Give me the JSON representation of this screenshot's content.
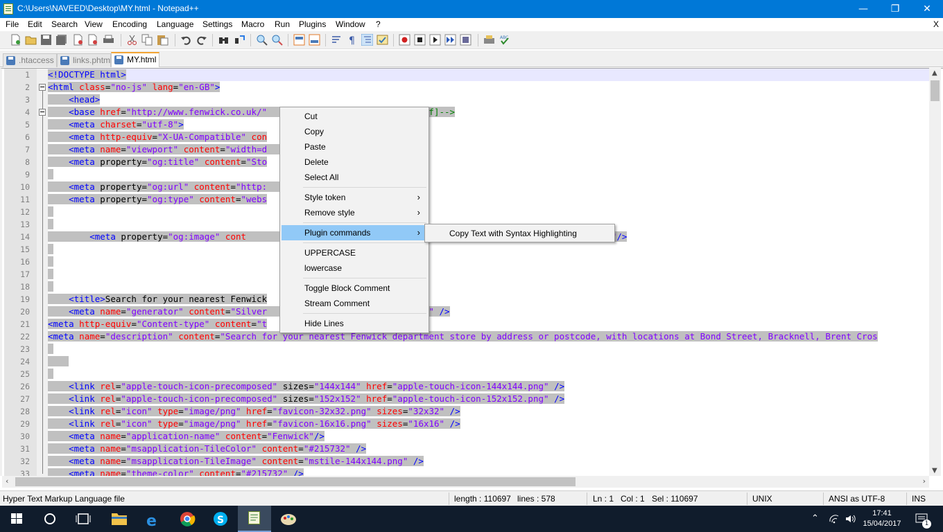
{
  "window": {
    "title": "C:\\Users\\NAVEED\\Desktop\\MY.html - Notepad++",
    "minimize": "—",
    "maximize": "❐",
    "close": "✕"
  },
  "menubar": {
    "items": [
      "File",
      "Edit",
      "Search",
      "View",
      "Encoding",
      "Language",
      "Settings",
      "Macro",
      "Run",
      "Plugins",
      "Window",
      "?"
    ],
    "doc_close": "X"
  },
  "tabs": [
    {
      "label": ".htaccess",
      "active": false
    },
    {
      "label": "links.phtml",
      "active": false
    },
    {
      "label": "MY.html",
      "active": true
    }
  ],
  "editor": {
    "lines": [
      {
        "n": "1",
        "indent": "",
        "html": "<span class=\"tg\">&lt;!DOCTYPE html&gt;</span>"
      },
      {
        "n": "2",
        "indent": "",
        "html": "<span class=\"tg\">&lt;html</span> <span class=\"at\">class</span>=<span class=\"vl\">\"no-js\"</span> <span class=\"at\">lang</span>=<span class=\"vl\">\"en-GB\"</span><span class=\"tg\">&gt;</span>"
      },
      {
        "n": "3",
        "indent": "    ",
        "html": "<span class=\"tg\">&lt;head&gt;</span>"
      },
      {
        "n": "4",
        "indent": "    ",
        "html": "<span class=\"tg\">&lt;base</span> <span class=\"at\">href</span>=<span class=\"vl\">\"http://www.fenwick.co.uk/\"</span>                         <span class=\"cm\">![endif]--&gt;</span>"
      },
      {
        "n": "5",
        "indent": "    ",
        "html": "<span class=\"tg\">&lt;meta</span> <span class=\"at\">charset</span>=<span class=\"vl\">\"utf-8\"</span><span class=\"tg\">&gt;</span>"
      },
      {
        "n": "6",
        "indent": "    ",
        "html": "<span class=\"tg\">&lt;meta</span> <span class=\"at\">http-equiv</span>=<span class=\"vl\">\"X-UA-Compatible\"</span> <span class=\"at\">con</span>"
      },
      {
        "n": "7",
        "indent": "    ",
        "html": "<span class=\"tg\">&lt;meta</span> <span class=\"at\">name</span>=<span class=\"vl\">\"viewport\"</span> <span class=\"at\">content</span>=<span class=\"vl\">\"width=d</span>                          <span class=\"vl\">1\"</span><span class=\"tg\">&gt;</span>"
      },
      {
        "n": "8",
        "indent": "    ",
        "html": "<span class=\"tg\">&lt;meta</span> property=<span class=\"vl\">\"og:title\"</span> <span class=\"at\">content</span>=<span class=\"vl\">\"Sto</span>"
      },
      {
        "n": "9",
        "indent": "",
        "html": " "
      },
      {
        "n": "10",
        "indent": "    ",
        "html": "<span class=\"tg\">&lt;meta</span> property=<span class=\"vl\">\"og:url\"</span> <span class=\"at\">content</span>=<span class=\"vl\">\"http:</span>                            <span class=\"vl\">\"</span><span class=\"tg\">/&gt;</span>"
      },
      {
        "n": "11",
        "indent": "    ",
        "html": "<span class=\"tg\">&lt;meta</span> property=<span class=\"vl\">\"og:type\"</span> <span class=\"at\">content</span>=<span class=\"vl\">\"webs</span>"
      },
      {
        "n": "12",
        "indent": "",
        "html": " "
      },
      {
        "n": "13",
        "indent": "",
        "html": " "
      },
      {
        "n": "14",
        "indent": "        ",
        "html": "<span class=\"tg\">&lt;meta</span> property=<span class=\"vl\">\"og:image\"</span> <span class=\"at\">cont</span>                                                          <span class=\"vl\">ogo--lrg.png\"</span><span class=\"tg\">/&gt;</span>"
      },
      {
        "n": "15",
        "indent": "",
        "html": " "
      },
      {
        "n": "16",
        "indent": "",
        "html": " "
      },
      {
        "n": "17",
        "indent": "",
        "html": " "
      },
      {
        "n": "18",
        "indent": "",
        "html": " "
      },
      {
        "n": "19",
        "indent": "    ",
        "html": "<span class=\"tg\">&lt;title&gt;</span>Search for your nearest Fenwick"
      },
      {
        "n": "20",
        "indent": "    ",
        "html": "<span class=\"tg\">&lt;meta</span> <span class=\"at\">name</span>=<span class=\"vl\">\"generator\"</span> <span class=\"at\">content</span>=<span class=\"vl\">\"Silver</span>                          <span class=\"vl\">e.org\"</span> <span class=\"tg\">/&gt;</span>"
      },
      {
        "n": "21",
        "indent": "",
        "html": "<span class=\"tg\">&lt;meta</span> <span class=\"at\">http-equiv</span>=<span class=\"vl\">\"Content-type\"</span> <span class=\"at\">content</span>=<span class=\"vl\">\"t</span>"
      },
      {
        "n": "22",
        "indent": "",
        "html": "<span class=\"tg\">&lt;meta</span> <span class=\"at\">name</span>=<span class=\"vl\">\"description\"</span> <span class=\"at\">content</span>=<span class=\"vl\">\"Search for your nearest Fenwick department store by address or postcode, with locations at Bond Street, Bracknell, Brent Cros</span>"
      },
      {
        "n": "23",
        "indent": "",
        "html": " "
      },
      {
        "n": "24",
        "indent": "",
        "html": "    "
      },
      {
        "n": "25",
        "indent": "",
        "html": " "
      },
      {
        "n": "26",
        "indent": "    ",
        "html": "<span class=\"tg\">&lt;link</span> <span class=\"at\">rel</span>=<span class=\"vl\">\"apple-touch-icon-precomposed\"</span> sizes=<span class=\"vl\">\"144x144\"</span> <span class=\"at\">href</span>=<span class=\"vl\">\"apple-touch-icon-144x144.png\"</span> <span class=\"tg\">/&gt;</span>"
      },
      {
        "n": "27",
        "indent": "    ",
        "html": "<span class=\"tg\">&lt;link</span> <span class=\"at\">rel</span>=<span class=\"vl\">\"apple-touch-icon-precomposed\"</span> sizes=<span class=\"vl\">\"152x152\"</span> <span class=\"at\">href</span>=<span class=\"vl\">\"apple-touch-icon-152x152.png\"</span> <span class=\"tg\">/&gt;</span>"
      },
      {
        "n": "28",
        "indent": "    ",
        "html": "<span class=\"tg\">&lt;link</span> <span class=\"at\">rel</span>=<span class=\"vl\">\"icon\"</span> <span class=\"at\">type</span>=<span class=\"vl\">\"image/png\"</span> <span class=\"at\">href</span>=<span class=\"vl\">\"favicon-32x32.png\"</span> <span class=\"at\">sizes</span>=<span class=\"vl\">\"32x32\"</span> <span class=\"tg\">/&gt;</span>"
      },
      {
        "n": "29",
        "indent": "    ",
        "html": "<span class=\"tg\">&lt;link</span> <span class=\"at\">rel</span>=<span class=\"vl\">\"icon\"</span> <span class=\"at\">type</span>=<span class=\"vl\">\"image/png\"</span> <span class=\"at\">href</span>=<span class=\"vl\">\"favicon-16x16.png\"</span> <span class=\"at\">sizes</span>=<span class=\"vl\">\"16x16\"</span> <span class=\"tg\">/&gt;</span>"
      },
      {
        "n": "30",
        "indent": "    ",
        "html": "<span class=\"tg\">&lt;meta</span> <span class=\"at\">name</span>=<span class=\"vl\">\"application-name\"</span> <span class=\"at\">content</span>=<span class=\"vl\">\"Fenwick\"</span><span class=\"tg\">/&gt;</span>"
      },
      {
        "n": "31",
        "indent": "    ",
        "html": "<span class=\"tg\">&lt;meta</span> <span class=\"at\">name</span>=<span class=\"vl\">\"msapplication-TileColor\"</span> <span class=\"at\">content</span>=<span class=\"vl\">\"#215732\"</span> <span class=\"tg\">/&gt;</span>"
      },
      {
        "n": "32",
        "indent": "    ",
        "html": "<span class=\"tg\">&lt;meta</span> <span class=\"at\">name</span>=<span class=\"vl\">\"msapplication-TileImage\"</span> <span class=\"at\">content</span>=<span class=\"vl\">\"mstile-144x144.png\"</span> <span class=\"tg\">/&gt;</span>"
      },
      {
        "n": "33",
        "indent": "    ",
        "html": "<span class=\"tg\">&lt;meta</span> <span class=\"at\">name</span>=<span class=\"vl\">\"theme-color\"</span> <span class=\"at\">content</span>=<span class=\"vl\">\"#215732\"</span> <span class=\"tg\">/&gt;</span>"
      }
    ]
  },
  "context_menu": {
    "items": [
      {
        "label": "Cut",
        "submenu": false,
        "highlighted": false
      },
      {
        "label": "Copy",
        "submenu": false,
        "highlighted": false
      },
      {
        "label": "Paste",
        "submenu": false,
        "highlighted": false
      },
      {
        "label": "Delete",
        "submenu": false,
        "highlighted": false
      },
      {
        "label": "Select All",
        "submenu": false,
        "highlighted": false
      },
      {
        "label": "Style token",
        "submenu": true,
        "highlighted": false
      },
      {
        "label": "Remove style",
        "submenu": true,
        "highlighted": false
      },
      {
        "label": "Plugin commands",
        "submenu": true,
        "highlighted": true
      },
      {
        "label": "UPPERCASE",
        "submenu": false,
        "highlighted": false
      },
      {
        "label": "lowercase",
        "submenu": false,
        "highlighted": false
      },
      {
        "label": "Toggle Block Comment",
        "submenu": false,
        "highlighted": false
      },
      {
        "label": "Stream Comment",
        "submenu": false,
        "highlighted": false
      },
      {
        "label": "Hide Lines",
        "submenu": false,
        "highlighted": false
      }
    ],
    "submenu_arrow": "›",
    "submenu": {
      "label": "Copy Text with Syntax Highlighting"
    }
  },
  "statusbar": {
    "file_type": "Hyper Text Markup Language file",
    "length": "length : 110697",
    "lines": "lines : 578",
    "ln": "Ln : 1",
    "col": "Col : 1",
    "sel": "Sel : 110697",
    "eol": "UNIX",
    "encoding": "ANSI as UTF-8",
    "mode": "INS"
  },
  "taskbar": {
    "time": "17:41",
    "date": "15/04/2017",
    "notification_count": "1"
  },
  "colors": {
    "title_bar": "#0078d7",
    "selection": "#c0c0c0",
    "menu_highlight": "#91c9f7",
    "tag": "#0000ff",
    "attribute": "#ff0000",
    "value": "#8000ff",
    "comment": "#008000"
  }
}
